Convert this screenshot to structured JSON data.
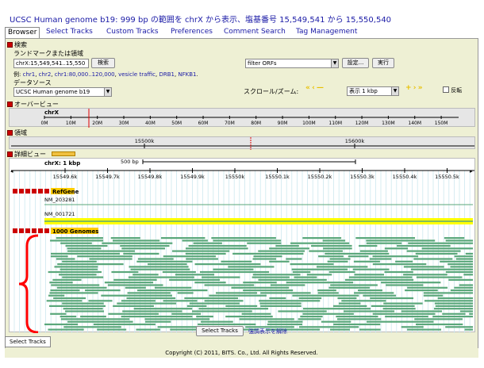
{
  "page": {
    "title": "UCSC Human genome b19: 999 bp の範囲を chrX から表示、塩基番号 15,549,541 から 15,550,540"
  },
  "tabs": [
    "Browser",
    "Select Tracks",
    "Custom Tracks",
    "Preferences",
    "Comment Search",
    "Tag Management"
  ],
  "search": {
    "header": "検索",
    "landmark_label": "ランドマークまたは領域",
    "landmark_value": "chrX:15,549,541..15,550",
    "search_button": "検索",
    "example_label": "例:",
    "examples": [
      "chr1",
      "chr2",
      "chr1:80,000..120,000",
      "vesicle traffic",
      "DRB1",
      "NFKB1"
    ],
    "datasource_label": "データソース",
    "datasource_value": "UCSC Human genome b19",
    "filter_value": "filter ORFs",
    "settings_button": "設定...",
    "run_button": "実行",
    "scroll_zoom_label": "スクロール/ズーム:",
    "zoom_value": "表示 1 kbp",
    "flip_label": "反転"
  },
  "overview": {
    "header": "オーバービュー",
    "chrom": "chrX",
    "ticks": [
      "0M",
      "10M",
      "20M",
      "30M",
      "40M",
      "50M",
      "60M",
      "70M",
      "80M",
      "90M",
      "100M",
      "110M",
      "120M",
      "130M",
      "140M",
      "150M"
    ]
  },
  "region": {
    "header": "領域",
    "ticks": [
      "15500k",
      "15600k"
    ]
  },
  "details": {
    "header": "詳細ビュー",
    "chrom_label": "chrX: 1 kbp",
    "scale_label": "500 bp",
    "ticks": [
      "15549.6k",
      "15549.7k",
      "15549.8k",
      "15549.9k",
      "15550k",
      "15550.1k",
      "15550.2k",
      "15550.3k",
      "15550.4k",
      "15550.5k"
    ],
    "refgene_track": "RefGene",
    "refgene_rows": [
      "NM_203281",
      "NM_001721"
    ],
    "genomes_track": "1000 Genomes"
  },
  "bottom": {
    "select_tracks_button": "Select Tracks",
    "clear_highlight_link": "強調表示を解除",
    "bottom_tab": "Select Tracks"
  },
  "footer": {
    "text": "Copyright (C) 2011, BITS. Co., Ltd. All Rights Reserved."
  },
  "colors": {
    "title": "#1a1aa6",
    "feature": "#5aa77a",
    "highlight": "#ffff00",
    "marker": "#e00000"
  }
}
